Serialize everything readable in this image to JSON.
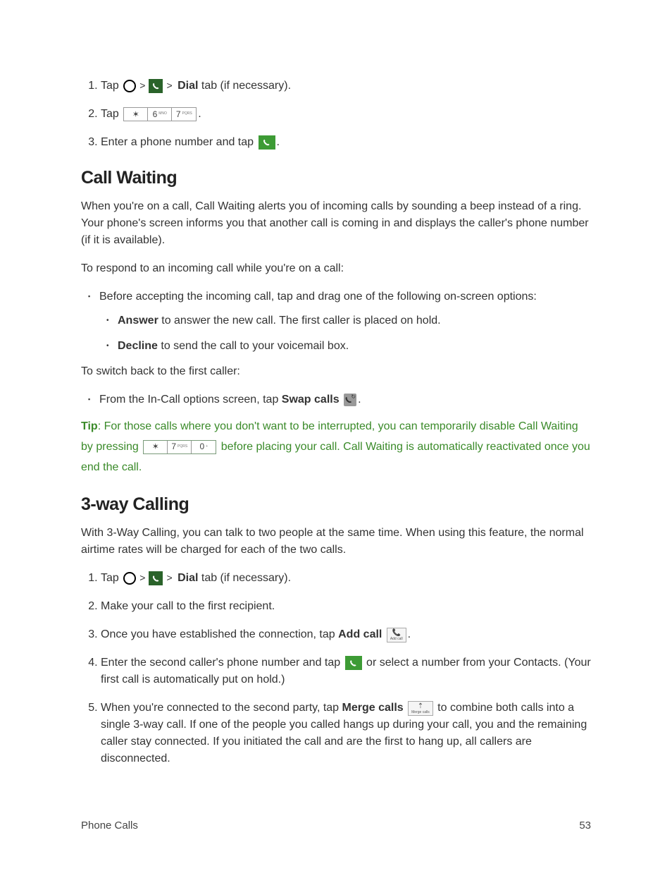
{
  "section_a": {
    "steps": [
      {
        "prefix": "Tap ",
        "dial": "Dial",
        "suffix": " tab (if necessary)."
      },
      {
        "prefix": "Tap ",
        "keys": [
          "✶",
          "6",
          "7"
        ],
        "suffix": "."
      },
      {
        "prefix": "Enter a phone number and tap ",
        "suffix": "."
      }
    ]
  },
  "call_waiting": {
    "heading": "Call Waiting",
    "p1": "When you're on a call, Call Waiting alerts you of incoming calls by sounding a beep instead of a ring. Your phone's screen informs you that another call is coming in and displays the caller's phone number (if it is available).",
    "p2": "To respond to an incoming call while you're on a call:",
    "bullet1": "Before accepting the incoming call, tap and drag one of the following on-screen options:",
    "sub1a_bold": "Answer",
    "sub1a_rest": " to answer the new call. The first caller is placed on hold.",
    "sub1b_bold": "Decline",
    "sub1b_rest": " to send the call to your voicemail box.",
    "p3": "To switch back to the first caller:",
    "bullet2_pre": "From the In-Call options screen, tap ",
    "bullet2_bold": "Swap calls",
    "bullet2_post": ".",
    "tip_label": "Tip",
    "tip_body_1": ": For those calls where you don't want to be interrupted, you can temporarily disable Call Waiting by pressing ",
    "tip_keys": [
      "✶",
      "7",
      "0"
    ],
    "tip_body_2": " before placing your call. Call Waiting is automatically reactivated once you end the call."
  },
  "three_way": {
    "heading": "3-way Calling",
    "p1": "With 3-Way Calling, you can talk to two people at the same time. When using this feature, the normal airtime rates will be charged for each of the two calls.",
    "step1_pre": "Tap ",
    "step1_dial": "Dial",
    "step1_post": " tab (if necessary).",
    "step2": "Make your call to the first recipient.",
    "step3_pre": "Once you have established the connection, tap ",
    "step3_bold": "Add call",
    "step3_btn": "Add call",
    "step3_post": ".",
    "step4_pre": "Enter the second caller's phone number and tap ",
    "step4_post": " or select a number from your Contacts. (Your first call is automatically put on hold.)",
    "step5_pre": "When you're connected to the second party, tap ",
    "step5_bold": "Merge calls",
    "step5_btn": "Merge calls",
    "step5_post": " to combine both calls into a single 3-way call. If one of the people you called hangs up during your call, you and the remaining caller stay connected. If you initiated the call and are the first to hang up, all callers are disconnected."
  },
  "footer": {
    "section": "Phone Calls",
    "page": "53"
  },
  "glyphs": {
    "gt": ">"
  },
  "key_subs": {
    "6": "MNO",
    "7": "PQRS",
    "0": "+"
  }
}
